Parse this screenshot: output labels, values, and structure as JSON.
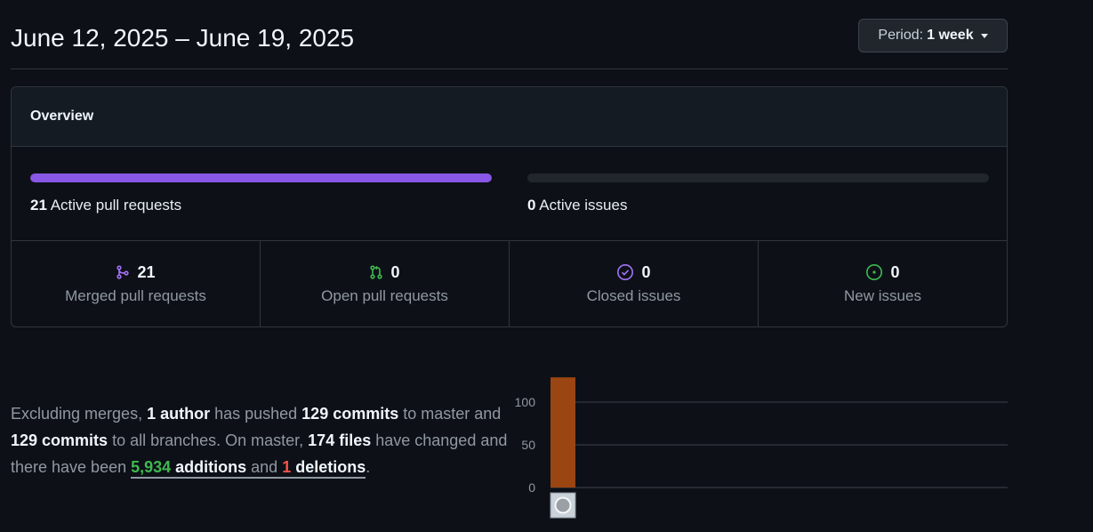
{
  "header": {
    "date_range": "June 12, 2025 – June 19, 2025",
    "period_label": "Period:",
    "period_value": "1 week"
  },
  "overview": {
    "title": "Overview",
    "active_prs": {
      "count": "21",
      "label": "Active pull requests",
      "fraction": 1.0,
      "color": "#8957e5"
    },
    "active_issues": {
      "count": "0",
      "label": "Active issues",
      "fraction": 0.0
    },
    "stats": [
      {
        "icon": "git-merge-icon",
        "count": "21",
        "label": "Merged pull requests",
        "color": "#a371f7"
      },
      {
        "icon": "git-pull-request-icon",
        "count": "0",
        "label": "Open pull requests",
        "color": "#3fb950"
      },
      {
        "icon": "issue-closed-icon",
        "count": "0",
        "label": "Closed issues",
        "color": "#a371f7"
      },
      {
        "icon": "issue-opened-icon",
        "count": "0",
        "label": "New issues",
        "color": "#3fb950"
      }
    ]
  },
  "summary": {
    "t1": "Excluding merges, ",
    "authors": "1 author",
    "t2": " has pushed ",
    "commits_master": "129 commits",
    "t3": " to master and ",
    "commits_all": "129 commits",
    "t4": " to all branches. On master, ",
    "files": "174 files",
    "t5": " have changed and there have been ",
    "additions_num": "5,934",
    "additions_word": " additions",
    "t6": " and ",
    "deletions_num": "1",
    "deletions_word": " deletions",
    "t7": "."
  },
  "chart_data": {
    "type": "bar",
    "categories": [
      "author-avatar"
    ],
    "values": [
      129
    ],
    "yticks": [
      "0",
      "50",
      "100"
    ],
    "ylim": [
      0,
      129
    ],
    "bar_color": "#9a4512",
    "grid": true
  }
}
